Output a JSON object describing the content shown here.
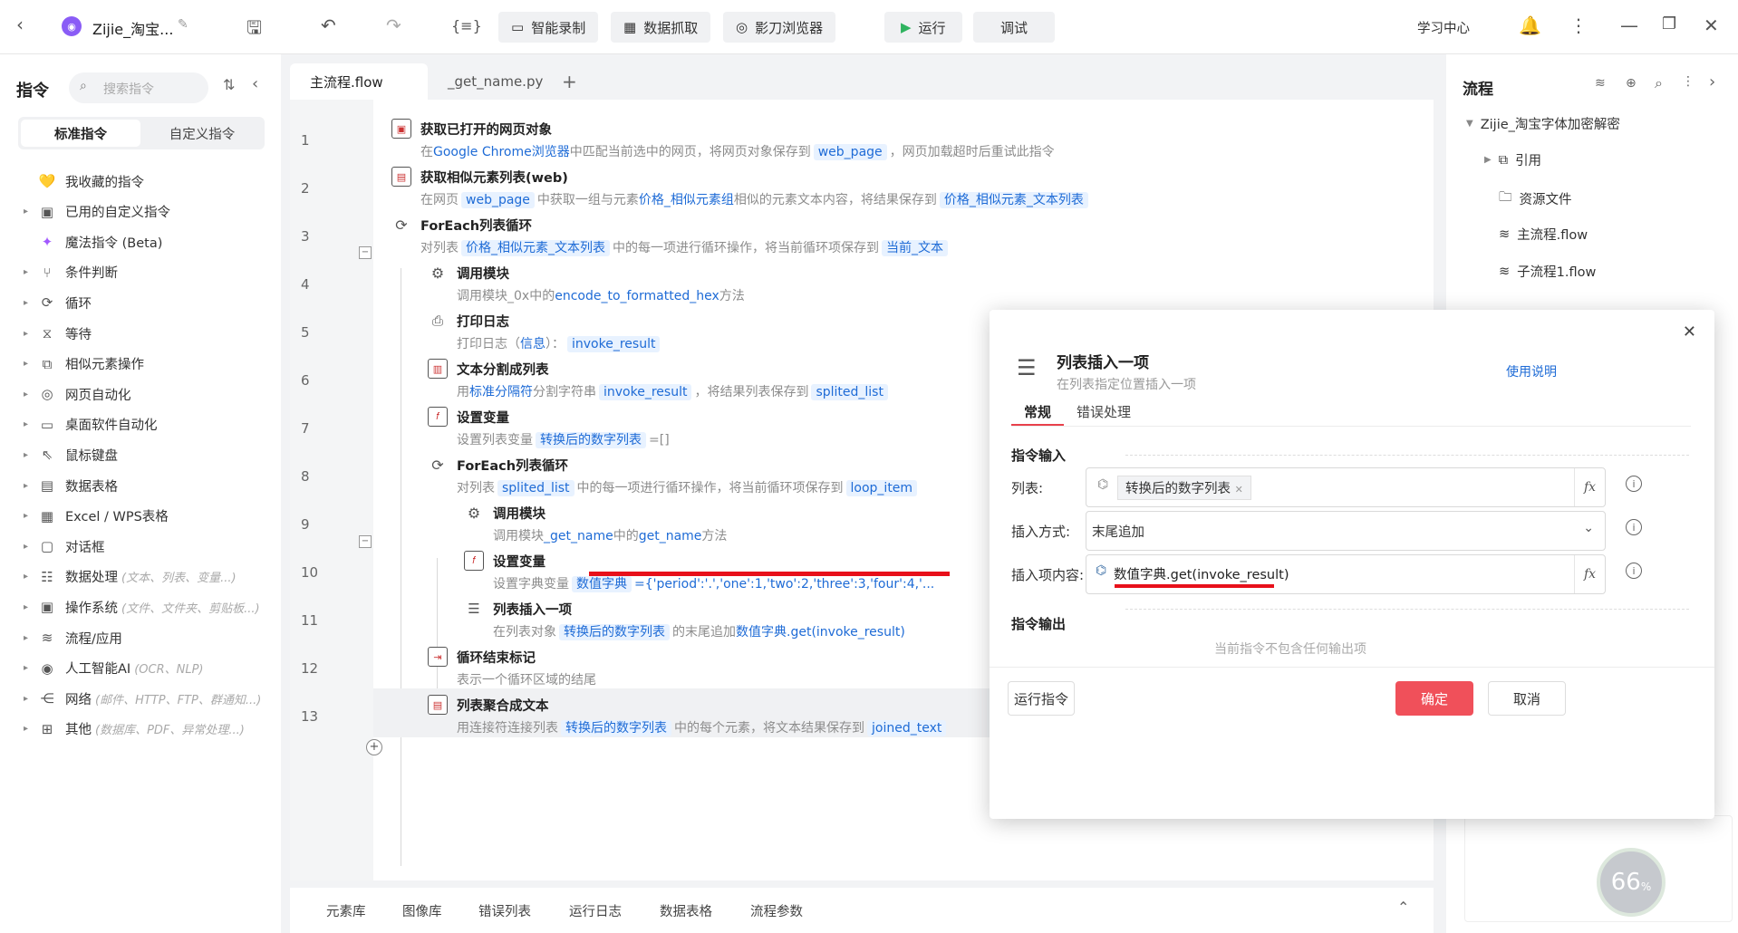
{
  "topbar": {
    "title": "Zijie_淘宝...",
    "smart_record": "智能录制",
    "data_grab": "数据抓取",
    "browser": "影刀浏览器",
    "run": "运行",
    "debug": "调试",
    "learn": "学习中心"
  },
  "left": {
    "title": "指令",
    "search_placeholder": "搜索指令",
    "tab_std": "标准指令",
    "tab_custom": "自定义指令",
    "cats": [
      {
        "label": "我收藏的指令",
        "sub": ""
      },
      {
        "label": "已用的自定义指令",
        "sub": ""
      },
      {
        "label": "魔法指令 (Beta)",
        "sub": ""
      },
      {
        "label": "条件判断",
        "sub": ""
      },
      {
        "label": "循环",
        "sub": ""
      },
      {
        "label": "等待",
        "sub": ""
      },
      {
        "label": "相似元素操作",
        "sub": ""
      },
      {
        "label": "网页自动化",
        "sub": ""
      },
      {
        "label": "桌面软件自动化",
        "sub": ""
      },
      {
        "label": "鼠标键盘",
        "sub": ""
      },
      {
        "label": "数据表格",
        "sub": ""
      },
      {
        "label": "Excel / WPS表格",
        "sub": ""
      },
      {
        "label": "对话框",
        "sub": ""
      },
      {
        "label": "数据处理",
        "sub": "(文本、列表、变量...)"
      },
      {
        "label": "操作系统",
        "sub": "(文件、文件夹、剪贴板...)"
      },
      {
        "label": "流程/应用",
        "sub": ""
      },
      {
        "label": "人工智能AI",
        "sub": "(OCR、NLP)"
      },
      {
        "label": "网络",
        "sub": "(邮件、HTTP、FTP、群通知...)"
      },
      {
        "label": "其他",
        "sub": "(数据库、PDF、异常处理...)"
      }
    ]
  },
  "tabs": {
    "main": "主流程.flow",
    "get_name": "_get_name.py"
  },
  "steps": {
    "s1": {
      "title": "获取已打开的网页对象",
      "d1": "在",
      "d2": "Google Chrome浏览器",
      "d3": "中匹配当前选中的网页，将网页对象保存到",
      "d4": "web_page",
      "d5": "，网页加载超时后重试此指令"
    },
    "s2": {
      "title": "获取相似元素列表(web)",
      "d1": "在网页",
      "d2": "web_page",
      "d3": "中获取一组与元素",
      "d4": "价格_相似元素组",
      "d5": "相似的元素文本内容，将结果保存到",
      "d6": "价格_相似元素_文本列表"
    },
    "s3": {
      "title": "ForEach列表循环",
      "d1": "对列表",
      "d2": "价格_相似元素_文本列表",
      "d3": "中的每一项进行循环操作，将当前循环项保存到",
      "d4": "当前_文本"
    },
    "s4": {
      "title": "调用模块",
      "d1": "调用模块_0x中的",
      "d2": "encode_to_formatted_hex",
      "d3": "方法"
    },
    "s5": {
      "title": "打印日志",
      "d1": "打印日志（",
      "d2": "信息",
      "d3": "）：",
      "d4": "invoke_result"
    },
    "s6": {
      "title": "文本分割成列表",
      "d1": "用",
      "d2": "标准分隔符",
      "d3": "分割字符串",
      "d4": "invoke_result",
      "d5": "，将结果列表保存到",
      "d6": "splited_list"
    },
    "s7": {
      "title": "设置变量",
      "d1": "设置列表变量",
      "d2": "转换后的数字列表",
      "d3": "=[]"
    },
    "s8": {
      "title": "ForEach列表循环",
      "d1": "对列表",
      "d2": "splited_list",
      "d3": "中的每一项进行循环操作，将当前循环项保存到",
      "d4": "loop_item"
    },
    "s9": {
      "title": "调用模块",
      "d1": "调用模块",
      "d2": "_get_name",
      "d3": "中的",
      "d4": "get_name",
      "d5": "方法"
    },
    "s10": {
      "title": "设置变量",
      "d1": "设置字典变量",
      "d2": "数值字典",
      "d3": "={'period':'.','one':1,'two':2,'three':3,'four':4,'..."
    },
    "s11": {
      "title": "列表插入一项",
      "d1": "在列表对象",
      "d2": "转换后的数字列表",
      "d3": "的末尾追加",
      "d4": "数值字典.get(invoke_result)"
    },
    "s12": {
      "title": "循环结束标记",
      "d1": "表示一个循环区域的结尾"
    },
    "s13": {
      "title": "列表聚合成文本",
      "d1": "用连接符连接列表",
      "d2": "转换后的数字列表",
      "d3": "中的每个元素，将文本结果保存到",
      "d4": "joined_text"
    }
  },
  "line_numbers": [
    "1",
    "2",
    "3",
    "4",
    "5",
    "6",
    "7",
    "8",
    "9",
    "10",
    "11",
    "12",
    "13"
  ],
  "bottom": [
    "元素库",
    "图像库",
    "错误列表",
    "运行日志",
    "数据表格",
    "流程参数"
  ],
  "right": {
    "title": "流程",
    "root": "Zijie_淘宝字体加密解密",
    "items": [
      "引用",
      "资源文件",
      "主流程.flow",
      "子流程1.flow"
    ],
    "progress": "66"
  },
  "dialog": {
    "title": "列表插入一项",
    "subtitle": "在列表指定位置插入一项",
    "help": "使用说明",
    "tab1": "常规",
    "tab2": "错误处理",
    "sec_in": "指令输入",
    "list_label": "列表:",
    "list_value": "转换后的数字列表",
    "mode_label": "插入方式:",
    "mode_value": "末尾追加",
    "item_label": "插入项内容:",
    "item_value": "数值字典.get(invoke_result)",
    "sec_out": "指令输出",
    "no_output": "当前指令不包含任何输出项",
    "run_btn": "运行指令",
    "ok": "确定",
    "cancel": "取消"
  }
}
